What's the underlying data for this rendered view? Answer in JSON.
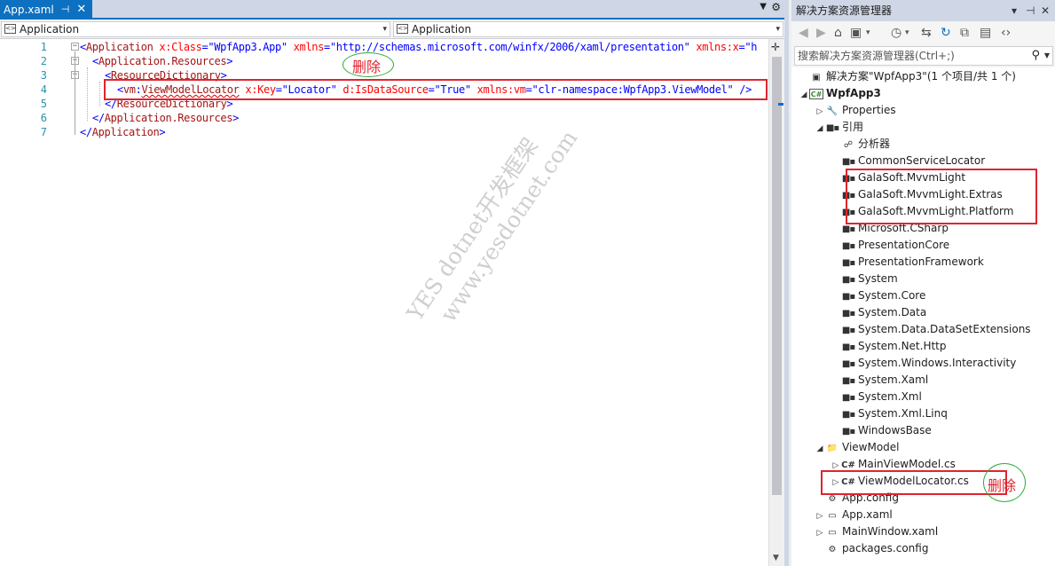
{
  "editor": {
    "tab": {
      "title": "App.xaml",
      "pin": "⊣",
      "close": "✕"
    },
    "navbar": {
      "left": "Application",
      "right": "Application"
    },
    "lines": [
      {
        "num": "1",
        "segments": [
          [
            "b",
            "<"
          ],
          [
            "t",
            "Application"
          ],
          [
            "a",
            " x:Class"
          ],
          [
            "b",
            "="
          ],
          [
            "s",
            "\"WpfApp3.App\""
          ],
          [
            "a",
            " xmlns"
          ],
          [
            "b",
            "="
          ],
          [
            "s",
            "\"http://schemas.microsoft.com/winfx/2006/xaml/presentation\""
          ],
          [
            "a",
            " xmlns:x"
          ],
          [
            "b",
            "="
          ],
          [
            "s",
            "\"h"
          ]
        ]
      },
      {
        "num": "2",
        "segments": [
          [
            "b",
            "<"
          ],
          [
            "t",
            "Application.Resources"
          ],
          [
            "b",
            ">"
          ]
        ]
      },
      {
        "num": "3",
        "segments": [
          [
            "b",
            "<"
          ],
          [
            "t",
            "ResourceDictionary"
          ],
          [
            "b",
            ">"
          ]
        ]
      },
      {
        "num": "4",
        "segments": [
          [
            "b",
            "<"
          ],
          [
            "t",
            "vm"
          ],
          [
            "b",
            ":"
          ],
          [
            "t",
            "ViewModelLocator"
          ],
          [
            "a",
            " x:Key"
          ],
          [
            "b",
            "="
          ],
          [
            "s",
            "\"Locator\""
          ],
          [
            "a",
            " d:IsDataSource"
          ],
          [
            "b",
            "="
          ],
          [
            "s",
            "\"True\""
          ],
          [
            "a",
            " xmlns:vm"
          ],
          [
            "b",
            "="
          ],
          [
            "s",
            "\"clr-namespace:WpfApp3.ViewModel\""
          ],
          [
            "b",
            " />"
          ]
        ]
      },
      {
        "num": "5",
        "segments": [
          [
            "b",
            "</"
          ],
          [
            "t",
            "ResourceDictionary"
          ],
          [
            "b",
            ">"
          ]
        ]
      },
      {
        "num": "6",
        "segments": [
          [
            "b",
            "</"
          ],
          [
            "t",
            "Application.Resources"
          ],
          [
            "b",
            ">"
          ]
        ]
      },
      {
        "num": "7",
        "segments": [
          [
            "b",
            "</"
          ],
          [
            "t",
            "Application"
          ],
          [
            "b",
            ">"
          ]
        ]
      }
    ]
  },
  "annotations": {
    "delete_label": "删除"
  },
  "watermark": {
    "line1": "YES dotnet开发框架",
    "line2": "www.yesdotnet.com"
  },
  "solution_explorer": {
    "title": "解决方案资源管理器",
    "search_placeholder": "搜索解决方案资源管理器(Ctrl+;)",
    "solution": "解决方案\"WpfApp3\"(1 个项目/共 1 个)",
    "project": "WpfApp3",
    "properties": "Properties",
    "references": "引用",
    "analyzer": "分析器",
    "refs": [
      "CommonServiceLocator",
      "GalaSoft.MvvmLight",
      "GalaSoft.MvvmLight.Extras",
      "GalaSoft.MvvmLight.Platform",
      "Microsoft.CSharp",
      "PresentationCore",
      "PresentationFramework",
      "System",
      "System.Core",
      "System.Data",
      "System.Data.DataSetExtensions",
      "System.Net.Http",
      "System.Windows.Interactivity",
      "System.Xaml",
      "System.Xml",
      "System.Xml.Linq",
      "WindowsBase"
    ],
    "viewmodel_folder": "ViewModel",
    "main_vm": "MainViewModel.cs",
    "locator_vm": "ViewModelLocator.cs",
    "app_config": "App.config",
    "app_xaml": "App.xaml",
    "main_window": "MainWindow.xaml",
    "packages": "packages.config"
  }
}
